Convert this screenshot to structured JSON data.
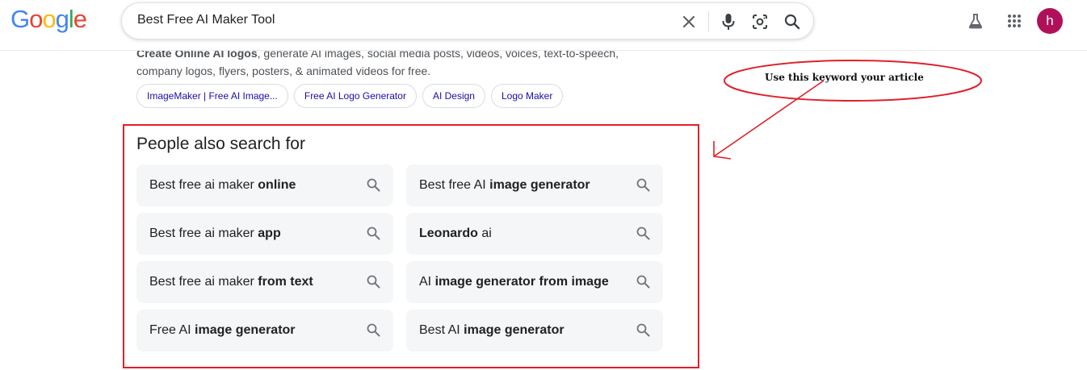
{
  "header": {
    "logo_letters": [
      {
        "ch": "G",
        "color": "#4285F4"
      },
      {
        "ch": "o",
        "color": "#EA4335"
      },
      {
        "ch": "o",
        "color": "#FBBC05"
      },
      {
        "ch": "g",
        "color": "#4285F4"
      },
      {
        "ch": "l",
        "color": "#34A853"
      },
      {
        "ch": "e",
        "color": "#EA4335"
      }
    ],
    "search_query": "Best Free AI Maker Tool",
    "icons": [
      "close-icon",
      "mic-icon",
      "lens-icon",
      "search-icon",
      "labs-icon",
      "apps-icon"
    ],
    "avatar_letter": "h",
    "avatar_color": "#b0105a"
  },
  "result": {
    "snippet_bold": "Create Online AI logos",
    "snippet_rest": ", generate AI images, social media posts, videos, voices, text-to-speech, company logos, flyers, posters, & animated videos for free.",
    "chips": [
      "ImageMaker | Free AI Image...",
      "Free AI Logo Generator",
      "AI Design",
      "Logo Maker"
    ]
  },
  "pasf": {
    "title": "People also search for",
    "items": [
      {
        "normal": "Best free ai maker ",
        "bold": "online",
        "after": ""
      },
      {
        "normal": "Best free AI ",
        "bold": "image generator",
        "after": ""
      },
      {
        "normal": "Best free ai maker ",
        "bold": "app",
        "after": ""
      },
      {
        "normal": "",
        "bold": "Leonardo",
        "after": " ai"
      },
      {
        "normal": "Best free ai maker ",
        "bold": "from text",
        "after": ""
      },
      {
        "normal": "AI ",
        "bold": "image generator from image",
        "after": ""
      },
      {
        "normal": "Free AI ",
        "bold": "image generator",
        "after": ""
      },
      {
        "normal": "Best AI ",
        "bold": "image generator",
        "after": ""
      }
    ]
  },
  "annotation": {
    "text": "Use this keyword your article",
    "color": "#e0202a"
  }
}
